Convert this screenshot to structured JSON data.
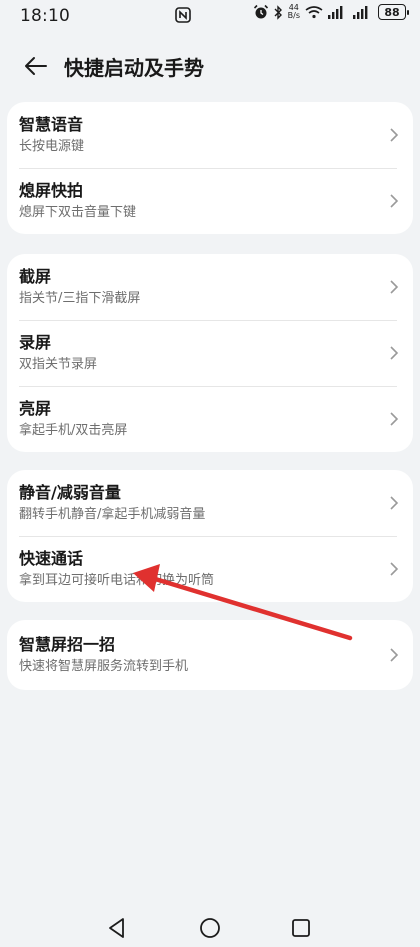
{
  "status_bar": {
    "time": "18:10",
    "net_speed_value": "44",
    "net_speed_unit": "B/s",
    "battery": "88",
    "icons": [
      "nfc-icon",
      "alarm-icon",
      "bluetooth-icon",
      "wifi-icon",
      "signal-icon",
      "signal-icon",
      "battery-icon"
    ]
  },
  "header": {
    "title": "快捷启动及手势",
    "back_icon": "arrow-left-icon"
  },
  "groups": [
    {
      "items": [
        {
          "title": "智慧语音",
          "subtitle": "长按电源键"
        },
        {
          "title": "熄屏快拍",
          "subtitle": "熄屏下双击音量下键"
        }
      ]
    },
    {
      "items": [
        {
          "title": "截屏",
          "subtitle": "指关节/三指下滑截屏"
        },
        {
          "title": "录屏",
          "subtitle": "双指关节录屏"
        },
        {
          "title": "亮屏",
          "subtitle": "拿起手机/双击亮屏"
        }
      ]
    },
    {
      "items": [
        {
          "title": "静音/减弱音量",
          "subtitle": "翻转手机静音/拿起手机减弱音量"
        },
        {
          "title": "快速通话",
          "subtitle": "拿到耳边可接听电话和切换为听筒"
        }
      ]
    },
    {
      "items": [
        {
          "title": "智慧屏招一招",
          "subtitle": "快速将智慧屏服务流转到手机"
        }
      ]
    }
  ],
  "colors": {
    "background": "#f1f3f5",
    "card": "#ffffff",
    "annotation_arrow": "#e0312f"
  },
  "nav_bar": {
    "icons": [
      "back-triangle-icon",
      "home-circle-icon",
      "recents-square-icon"
    ]
  }
}
